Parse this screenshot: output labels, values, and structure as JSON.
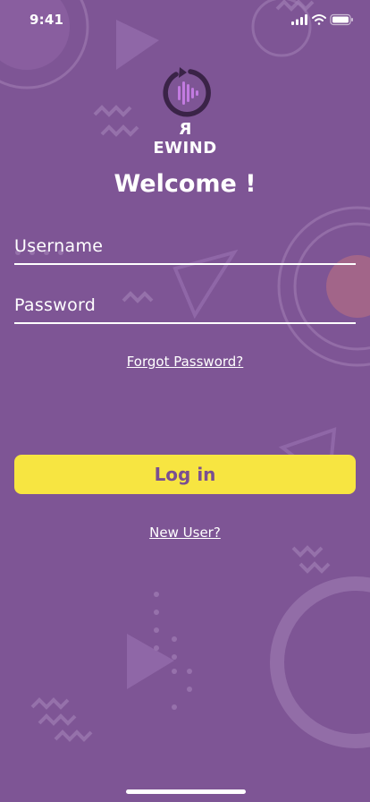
{
  "status_bar": {
    "time": "9:41",
    "icons": [
      "signal-icon",
      "wifi-icon",
      "battery-icon"
    ]
  },
  "logo": {
    "text_reversed_letter": "R",
    "text_rest": "EWIND",
    "icon": "rewind-logo-icon"
  },
  "welcome": {
    "title": "Welcome !"
  },
  "form": {
    "username_placeholder": "Username",
    "password_placeholder": "Password",
    "forgot_password": "Forgot Password?",
    "login_label": "Log in",
    "new_user": "New User?"
  },
  "colors": {
    "background": "#7e5595",
    "accent_button": "#f7e541",
    "button_text": "#7a4f91",
    "logo_dark": "#3a2347",
    "logo_wave": "#c27be0"
  }
}
